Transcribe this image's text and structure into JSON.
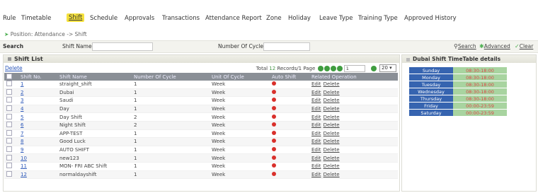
{
  "nav": {
    "tabs": [
      {
        "label": "Rule"
      },
      {
        "label": "Timetable"
      },
      {
        "label": "Shift"
      },
      {
        "label": "Schedule"
      },
      {
        "label": "Approvals"
      },
      {
        "label": "Transactions"
      },
      {
        "label": "Attendance Report"
      },
      {
        "label": "Zone"
      },
      {
        "label": "Holiday"
      },
      {
        "label": "Leave Type"
      },
      {
        "label": "Training Type"
      },
      {
        "label": "Approved History"
      }
    ]
  },
  "breadcrumb": "Position: Attendance -> Shift",
  "search": {
    "title": "Search",
    "shift_name_label": "Shift Name",
    "shift_name_value": "",
    "cycle_label": "Number Of Cycle",
    "cycle_value": "",
    "search_link": "Search",
    "advanced_link": "Advanced",
    "clear_link": "Clear"
  },
  "shift_list": {
    "title": "Shift List",
    "delete_link": "Delete",
    "pager": {
      "prefix": "Total",
      "records": "12",
      "middle": "Records/1",
      "page_label": "Page",
      "page_value": "1",
      "page_size": "20"
    },
    "columns": [
      "Shift No.",
      "Shift Name",
      "Number Of Cycle",
      "Unit Of Cycle",
      "Auto Shift",
      "Related Operation"
    ],
    "edit_label": "Edit",
    "delete_label": "Delete",
    "rows": [
      {
        "no": "1",
        "name": "straight_shift",
        "cycle": "1",
        "unit": "Week"
      },
      {
        "no": "2",
        "name": "Dubai",
        "cycle": "1",
        "unit": "Week"
      },
      {
        "no": "3",
        "name": "Saudi",
        "cycle": "1",
        "unit": "Week"
      },
      {
        "no": "4",
        "name": "Day",
        "cycle": "1",
        "unit": "Week"
      },
      {
        "no": "5",
        "name": "Day Shift",
        "cycle": "2",
        "unit": "Week"
      },
      {
        "no": "6",
        "name": "Night Shift",
        "cycle": "2",
        "unit": "Week"
      },
      {
        "no": "7",
        "name": "APP-TEST",
        "cycle": "1",
        "unit": "Week"
      },
      {
        "no": "8",
        "name": "Good Luck",
        "cycle": "1",
        "unit": "Week"
      },
      {
        "no": "9",
        "name": "AUTO SHIFT",
        "cycle": "1",
        "unit": "Week"
      },
      {
        "no": "10",
        "name": "new123",
        "cycle": "1",
        "unit": "Week"
      },
      {
        "no": "11",
        "name": "MON- FRI ABC Shift",
        "cycle": "1",
        "unit": "Week"
      },
      {
        "no": "12",
        "name": "normaldayshift",
        "cycle": "1",
        "unit": "Week"
      }
    ]
  },
  "timetable": {
    "title": "Dubai Shift TimeTable details",
    "days": [
      {
        "day": "Sunday",
        "time": "08:30-18:00"
      },
      {
        "day": "Monday",
        "time": "08:30-18:00"
      },
      {
        "day": "Tuesday",
        "time": "08:30-18:00"
      },
      {
        "day": "Wednesday",
        "time": "08:30-18:00"
      },
      {
        "day": "Thursday",
        "time": "08:30-18:00"
      },
      {
        "day": "Friday",
        "time": "00:00-23:59"
      },
      {
        "day": "Saturday",
        "time": "00:00-23:59"
      }
    ]
  }
}
